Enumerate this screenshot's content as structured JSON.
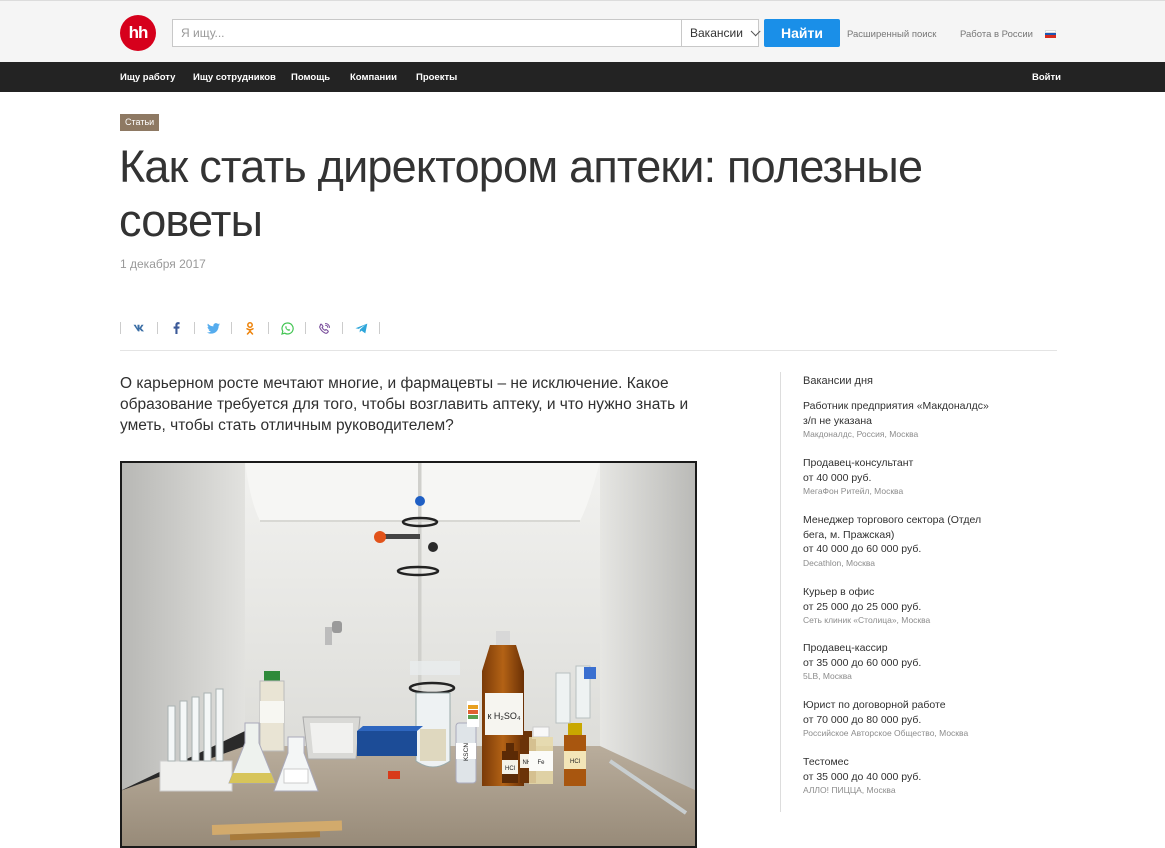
{
  "header": {
    "logo_text": "hh",
    "search_placeholder": "Я ищу...",
    "search_type": "Вакансии",
    "search_button": "Найти",
    "advanced_search": "Расширенный поиск",
    "region": "Работа в России",
    "flag_colors": [
      "#ffffff",
      "#1c57b5",
      "#d52b1e"
    ]
  },
  "nav": {
    "items": [
      "Ищу работу",
      "Ищу сотрудников",
      "Помощь",
      "Компании",
      "Проекты"
    ],
    "login": "Войти"
  },
  "article": {
    "tag": "Статьи",
    "title": "Как стать директором аптеки: полезные советы",
    "date": "1 декабря 2017",
    "share_icons": [
      "vk-icon",
      "facebook-icon",
      "twitter-icon",
      "odnoklassniki-icon",
      "whatsapp-icon",
      "viber-icon",
      "telegram-icon"
    ],
    "lead": "О карьерном росте мечтают многие, и фармацевты – не исключение. Какое образование требуется для того, чтобы возглавить аптеку, и что нужно знать и уметь, чтобы стать отличным руководителем?",
    "photo_labels": [
      "к H₂SO₄",
      "KSCN",
      "HCl",
      "NH₄",
      "Fe",
      "HCl"
    ]
  },
  "sidebar": {
    "title": "Вакансии дня",
    "vacancies": [
      {
        "name": "Работник предприятия «Макдоналдс»",
        "salary": "з/п не указана",
        "company": "Макдоналдс, Россия, Москва"
      },
      {
        "name": "Продавец-консультант",
        "salary": "от 40 000 руб.",
        "company": "МегаФон Ритейл, Москва"
      },
      {
        "name": "Менеджер торгового сектора (Отдел бега, м. Пражская)",
        "salary": "от 40 000 до 60 000 руб.",
        "company": "Decathlon, Москва"
      },
      {
        "name": "Курьер в офис",
        "salary": "от 25 000 до 25 000 руб.",
        "company": "Сеть клиник «Столица», Москва"
      },
      {
        "name": "Продавец-кассир",
        "salary": "от 35 000 до 60 000 руб.",
        "company": "5LB, Москва"
      },
      {
        "name": "Юрист по договорной работе",
        "salary": "от 70 000 до 80 000 руб.",
        "company": "Российское Авторское Общество, Москва"
      },
      {
        "name": "Тестомес",
        "salary": "от 35 000 до 40 000 руб.",
        "company": "АЛЛО! ПИЦЦА, Москва"
      }
    ]
  },
  "colors": {
    "brand_red": "#d6001c",
    "search_button": "#1a8fe8",
    "nav_bg": "#232323",
    "tag_bg": "#8e7963"
  }
}
